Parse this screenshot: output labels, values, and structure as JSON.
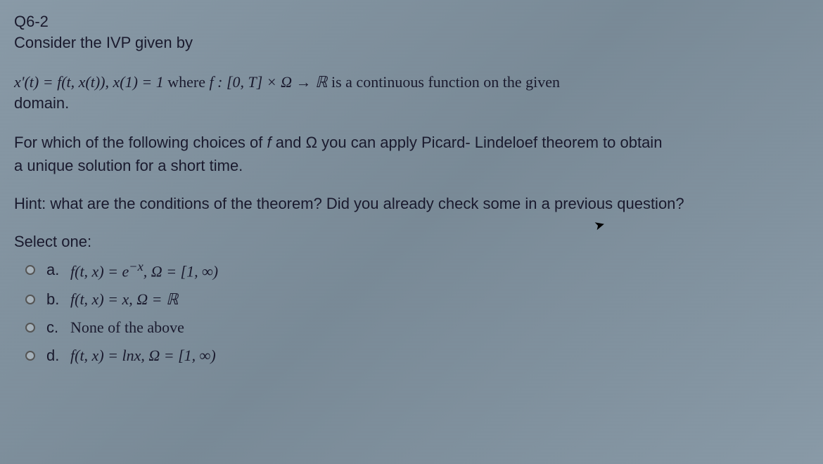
{
  "header": {
    "question_number": "Q6-2",
    "intro": "Consider the IVP given by"
  },
  "equation": {
    "line1_prefix": "x'(t) = f(t, x(t)), x(1) = 1",
    "line1_where": " where ",
    "line1_func": "f : [0, T] × Ω → ℝ",
    "line1_suffix": " is a continuous function on the given",
    "line2": "domain."
  },
  "question": {
    "line1": "For which of the following choices of f and Ω you can apply Picard- Lindeloef theorem to obtain",
    "line2": "a unique solution for a short time."
  },
  "hint": "Hint: what are the conditions of the theorem? Did you already check some in a previous question?",
  "select_label": "Select one:",
  "options": {
    "a": {
      "letter": "a.",
      "content_prefix": "f(t, x) = e",
      "content_exp": "−x",
      "content_suffix": ", Ω = [1, ∞)"
    },
    "b": {
      "letter": "b.",
      "content": "f(t, x) = x, Ω = ℝ"
    },
    "c": {
      "letter": "c.",
      "content": "None of the above"
    },
    "d": {
      "letter": "d.",
      "content": "f(t, x) = lnx, Ω = [1, ∞)"
    }
  }
}
